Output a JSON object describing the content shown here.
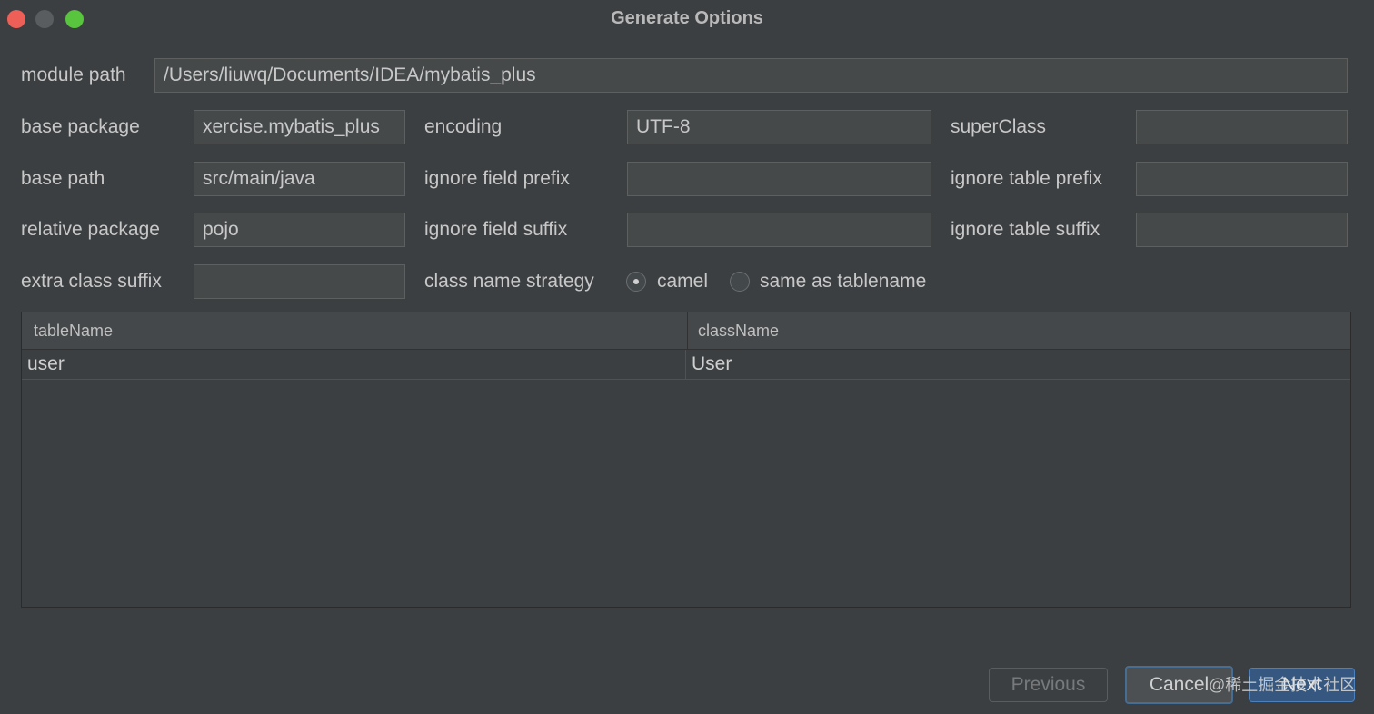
{
  "window": {
    "title": "Generate Options"
  },
  "form": {
    "module_path": {
      "label": "module path",
      "value": "/Users/liuwq/Documents/IDEA/mybatis_plus"
    },
    "base_package": {
      "label": "base package",
      "value": "xercise.mybatis_plus"
    },
    "base_path": {
      "label": "base path",
      "value": "src/main/java"
    },
    "relative_package": {
      "label": "relative package",
      "value": "pojo"
    },
    "extra_class_suffix": {
      "label": "extra class suffix",
      "value": ""
    },
    "encoding": {
      "label": "encoding",
      "value": "UTF-8"
    },
    "ignore_field_prefix": {
      "label": "ignore field prefix",
      "value": ""
    },
    "ignore_field_suffix": {
      "label": "ignore field suffix",
      "value": ""
    },
    "class_name_strategy": {
      "label": "class name strategy",
      "options": [
        "camel",
        "same as tablename"
      ],
      "selected": "camel"
    },
    "super_class": {
      "label": "superClass",
      "value": ""
    },
    "ignore_table_prefix": {
      "label": "ignore table prefix",
      "value": ""
    },
    "ignore_table_suffix": {
      "label": "ignore table suffix",
      "value": ""
    }
  },
  "table": {
    "columns": [
      "tableName",
      "className"
    ],
    "rows": [
      [
        "user",
        "User"
      ]
    ]
  },
  "buttons": {
    "previous": "Previous",
    "cancel": "Cancel",
    "next": "Next"
  },
  "watermark": "@稀土掘金技术社区",
  "colors": {
    "background": "#3c3f41",
    "field_bg": "#45494a",
    "accent": "#365880",
    "close": "#ee5f58",
    "maximize": "#59c53f"
  }
}
